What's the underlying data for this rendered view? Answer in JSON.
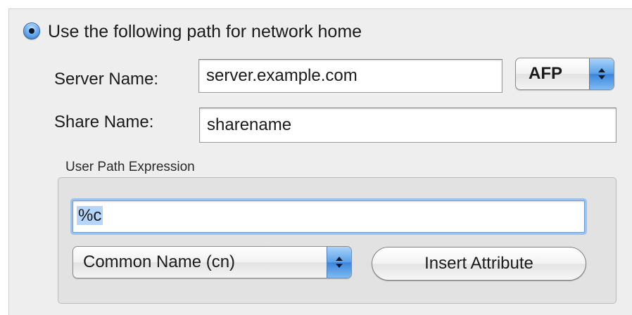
{
  "network_home": {
    "radio_label": "Use the following path for network home",
    "radio_selected": true
  },
  "server": {
    "label": "Server Name:",
    "value": "server.example.com",
    "protocol": "AFP"
  },
  "share": {
    "label": "Share Name:",
    "value": "sharename"
  },
  "user_path": {
    "group_title": "User Path Expression",
    "expression": "%c",
    "attribute_popup": "Common Name (cn)",
    "insert_button": "Insert Attribute"
  },
  "colors": {
    "accent": "#3a86dc",
    "focus_ring": "#9cc3ec",
    "selection": "#b5d5fb"
  },
  "icons": {
    "radio": "radio-selected-icon",
    "popup_arrows": "up-down-arrows-icon"
  }
}
